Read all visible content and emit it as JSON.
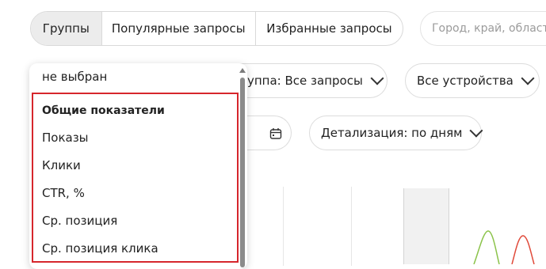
{
  "tabs": [
    {
      "label": "Группы",
      "active": true
    },
    {
      "label": "Популярные запросы",
      "active": false
    },
    {
      "label": "Избранные запросы",
      "active": false
    }
  ],
  "search": {
    "placeholder": "Город, край, область"
  },
  "filters": {
    "group_label": "уппа: Все запросы",
    "devices_label": "Все устройства",
    "detail_label": "Детализация: по дням"
  },
  "dropdown": {
    "selected": "не выбран",
    "section_title": "Общие показатели",
    "items": [
      "Показы",
      "Клики",
      "CTR, %",
      "Ср. позиция",
      "Ср. позиция клика"
    ]
  },
  "colors": {
    "highlight": "#d6262c",
    "series_green": "#8bc34a",
    "series_red": "#e04a3a"
  },
  "icons": [
    "calendar-icon",
    "chevron-down-icon"
  ]
}
